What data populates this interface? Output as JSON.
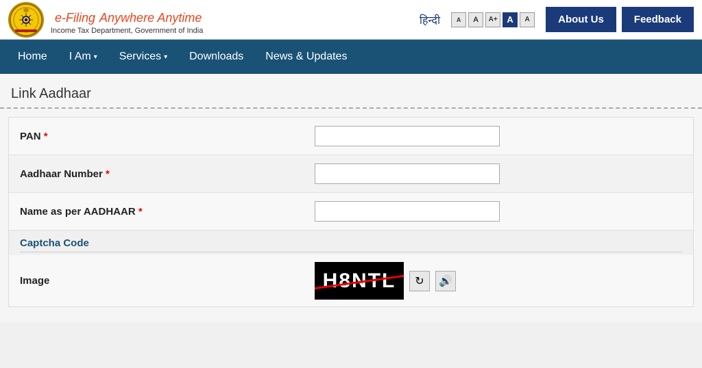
{
  "header": {
    "brand_name": "e-Filing",
    "brand_tagline": "Anywhere Anytime",
    "brand_subtitle": "Income Tax Department, Government of India",
    "hindi_label": "हिन्दी",
    "font_controls": [
      "A",
      "A",
      "A+",
      "A",
      "A"
    ],
    "about_label": "About Us",
    "feedback_label": "Feedback"
  },
  "navbar": {
    "items": [
      {
        "label": "Home",
        "has_arrow": false
      },
      {
        "label": "I Am",
        "has_arrow": true
      },
      {
        "label": "Services",
        "has_arrow": true
      },
      {
        "label": "Downloads",
        "has_arrow": false
      },
      {
        "label": "News & Updates",
        "has_arrow": false
      }
    ]
  },
  "page": {
    "title": "Link Aadhaar"
  },
  "form": {
    "fields": [
      {
        "label": "PAN",
        "required": true,
        "placeholder": ""
      },
      {
        "label": "Aadhaar Number",
        "required": true,
        "placeholder": ""
      },
      {
        "label": "Name as per AADHAAR",
        "required": true,
        "placeholder": ""
      }
    ],
    "captcha_section_title": "Captcha Code",
    "captcha_label": "Image",
    "captcha_text": "H8NTL",
    "refresh_icon": "↻",
    "audio_icon": "🔊"
  }
}
